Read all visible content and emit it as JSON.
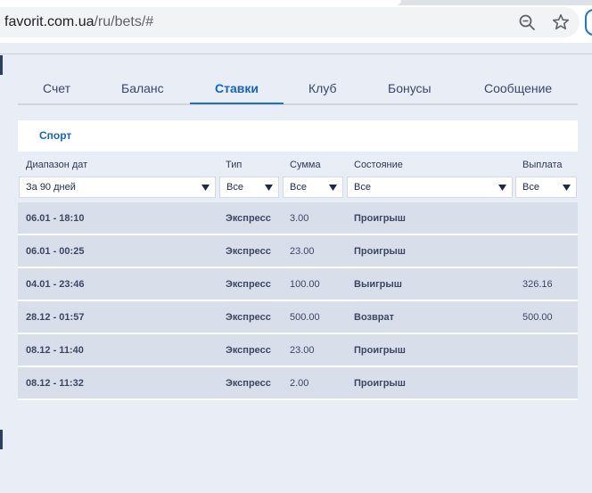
{
  "browser": {
    "url_host": "favorit.com.ua",
    "url_path": "/ru/bets/#"
  },
  "tabs": [
    {
      "label": "Счет",
      "active": false
    },
    {
      "label": "Баланс",
      "active": false
    },
    {
      "label": "Ставки",
      "active": true
    },
    {
      "label": "Клуб",
      "active": false
    },
    {
      "label": "Бонусы",
      "active": false
    },
    {
      "label": "Сообщение",
      "active": false
    }
  ],
  "section": {
    "label": "Спорт"
  },
  "filters": {
    "date_range": {
      "label": "Диапазон дат",
      "value": "За 90 дней"
    },
    "type": {
      "label": "Тип",
      "value": "Все"
    },
    "sum": {
      "label": "Сумма",
      "value": "Все"
    },
    "state": {
      "label": "Состояние",
      "value": "Все"
    },
    "payout": {
      "label": "Выплата",
      "value": "Все"
    }
  },
  "bets": [
    {
      "date": "06.01 - 18:10",
      "type": "Экспресс",
      "sum": "3.00",
      "state": "Проигрыш",
      "payout": ""
    },
    {
      "date": "06.01 - 00:25",
      "type": "Экспресс",
      "sum": "23.00",
      "state": "Проигрыш",
      "payout": ""
    },
    {
      "date": "04.01 - 23:46",
      "type": "Экспресс",
      "sum": "100.00",
      "state": "Выигрыш",
      "payout": "326.16"
    },
    {
      "date": "28.12 - 01:57",
      "type": "Экспресс",
      "sum": "500.00",
      "state": "Возврат",
      "payout": "500.00"
    },
    {
      "date": "08.12 - 11:40",
      "type": "Экспресс",
      "sum": "23.00",
      "state": "Проигрыш",
      "payout": ""
    },
    {
      "date": "08.12 - 11:32",
      "type": "Экспресс",
      "sum": "2.00",
      "state": "Проигрыш",
      "payout": ""
    }
  ],
  "colors": {
    "accent": "#1565c0",
    "page_bg": "#e9edf5",
    "row_bg": "#d9dfea"
  }
}
